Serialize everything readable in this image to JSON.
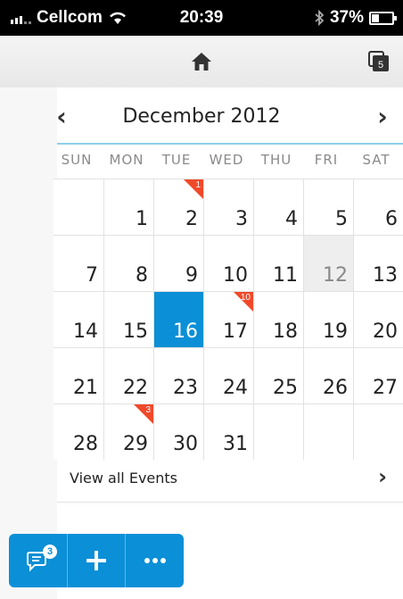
{
  "status_bar": {
    "carrier": "Cellcom",
    "time": "20:39",
    "battery": "37%",
    "icons": [
      "signal-icon",
      "wifi-icon",
      "bluetooth-icon",
      "battery-icon"
    ]
  },
  "navbar": {
    "home_icon": "home-icon",
    "pages_icon": "pages-icon",
    "pages_count": "5"
  },
  "calendar": {
    "month_title": "December 2012",
    "prev": "‹",
    "next": "›",
    "weekdays": [
      "SUN",
      "MON",
      "TUE",
      "WED",
      "THU",
      "FRI",
      "SAT"
    ],
    "weeks": [
      [
        "",
        "1",
        "2",
        "3",
        "4",
        "5",
        "6"
      ],
      [
        "7",
        "8",
        "9",
        "10",
        "11",
        "12",
        "13"
      ],
      [
        "14",
        "15",
        "16",
        "17",
        "18",
        "19",
        "20"
      ],
      [
        "21",
        "22",
        "23",
        "24",
        "25",
        "26",
        "27"
      ],
      [
        "28",
        "29",
        "30",
        "31",
        "",
        "",
        ""
      ]
    ],
    "selected_day": "16",
    "today_day": "12",
    "event_badges": {
      "2": "1",
      "17": "10",
      "29": "3"
    },
    "colors": {
      "selected": "#0b8fd6",
      "badge": "#f0492a",
      "rule": "#8ecfe8"
    }
  },
  "view_all": {
    "label": "View all Events",
    "chevron": "›"
  },
  "toolbar": {
    "messages_count": "3",
    "messages_icon": "chat-icon",
    "add_icon": "plus-icon",
    "more_icon": "more-icon"
  }
}
